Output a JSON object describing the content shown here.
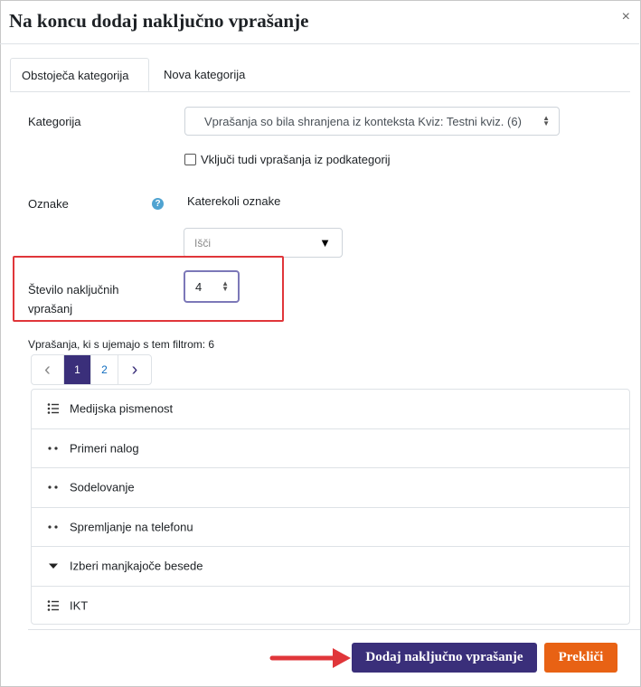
{
  "dialog": {
    "title": "Na koncu dodaj naključno vprašanje",
    "close_glyph": "×"
  },
  "tabs": [
    {
      "label": "Obstoječa kategorija",
      "active": true
    },
    {
      "label": "Nova kategorija",
      "active": false
    }
  ],
  "form": {
    "category_label": "Kategorija",
    "category_value": "Vprašanja so bila shranjena iz konteksta Kviz: Testni kviz. (6)",
    "subcat_checkbox_label": "Vključi tudi vprašanja iz podkategorij",
    "subcat_checked": false,
    "tags_label": "Oznake",
    "tags_help_glyph": "?",
    "tags_any_text": "Katerekoli oznake",
    "tags_search_placeholder": "Išči",
    "count_label_line1": "Število naključnih",
    "count_label_line2": "vprašanj",
    "count_value": "4"
  },
  "filter_summary": "Vprašanja, ki s ujemajo s tem filtrom: 6",
  "pagination": {
    "prev": "‹",
    "pages": [
      "1",
      "2"
    ],
    "current": "1",
    "next": "›"
  },
  "questions": [
    {
      "name": "Medijska pismenost",
      "icon": "multichoice-icon"
    },
    {
      "name": "Primeri nalog",
      "icon": "ddwtos-icon"
    },
    {
      "name": "Sodelovanje",
      "icon": "ddwtos-icon"
    },
    {
      "name": "Spremljanje na telefonu",
      "icon": "ddwtos-icon"
    },
    {
      "name": "Izberi manjkajoče besede",
      "icon": "gapselect-icon"
    },
    {
      "name": "IKT",
      "icon": "multichoice-icon"
    }
  ],
  "buttons": {
    "add": "Dodaj naključno vprašanje",
    "cancel": "Prekliči"
  },
  "colors": {
    "primary": "#3a2f7a",
    "cancel": "#e86214",
    "highlight": "#e0363a"
  }
}
